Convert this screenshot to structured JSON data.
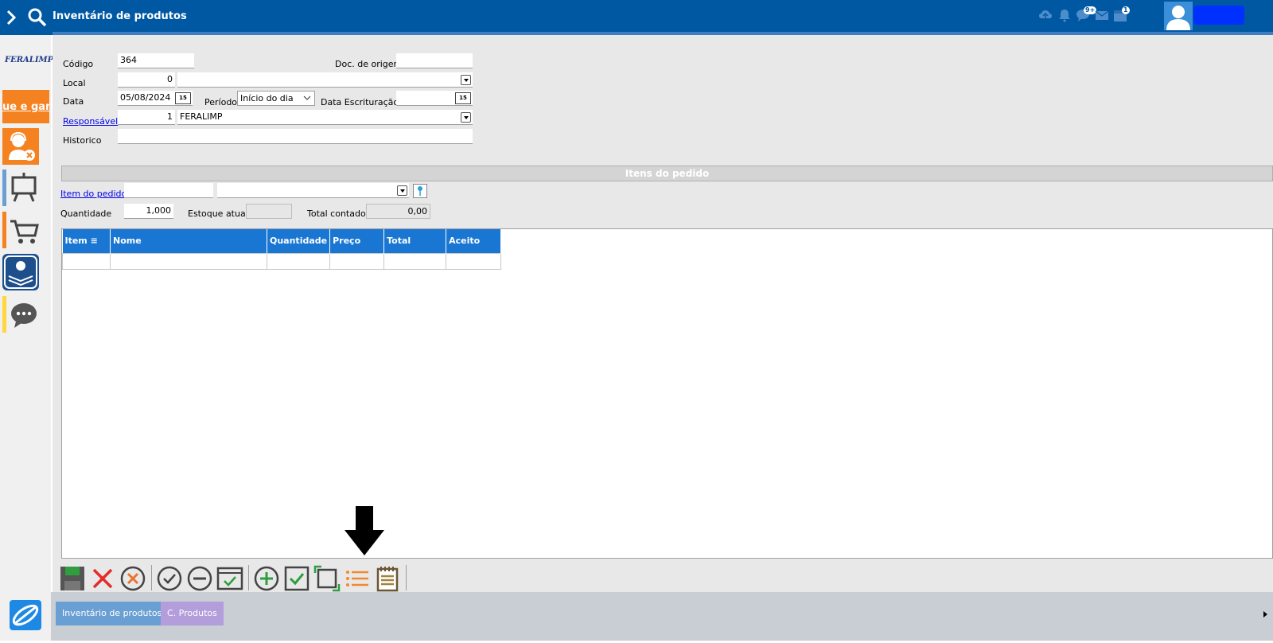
{
  "header": {
    "title": "Inventário de produtos",
    "badge_chat": "9+",
    "badge_calendar": "1"
  },
  "sidebar": {
    "logo": "FERALIMP",
    "promo": "ue e ganh"
  },
  "form": {
    "codigo_label": "Código",
    "codigo_value": "364",
    "doc_origem_label": "Doc. de origem",
    "doc_origem_value": "",
    "local_label": "Local",
    "local_value": "0",
    "local_desc": "",
    "data_label": "Data",
    "data_value": "05/08/2024",
    "periodo_label": "Período",
    "periodo_value": "Início do dia",
    "data_escrit_label": "Data Escrituração",
    "data_escrit_value": "",
    "responsavel_label": "Responsável",
    "responsavel_value": "1",
    "responsavel_desc": "FERALIMP",
    "historico_label": "Historico",
    "historico_value": ""
  },
  "itens": {
    "section_title": "Itens do pedido",
    "item_label": "Item do pedido",
    "quantidade_label": "Quantidade",
    "quantidade_value": "1,000",
    "estoque_label": "Estoque atual",
    "estoque_value": "",
    "total_label": "Total contado",
    "total_value": "0,00"
  },
  "grid": {
    "columns": [
      "Item",
      "Nome",
      "Quantidade",
      "Preço",
      "Total",
      "Aceito"
    ]
  },
  "taskbar": {
    "tabs": [
      "Inventário de produtos",
      "C. Produtos"
    ]
  },
  "colors": {
    "header": "#0058a3",
    "grid_header": "#1976d2",
    "accent_orange": "#f58220",
    "tab1": "#6a9fd4",
    "tab2": "#b39ddb"
  }
}
